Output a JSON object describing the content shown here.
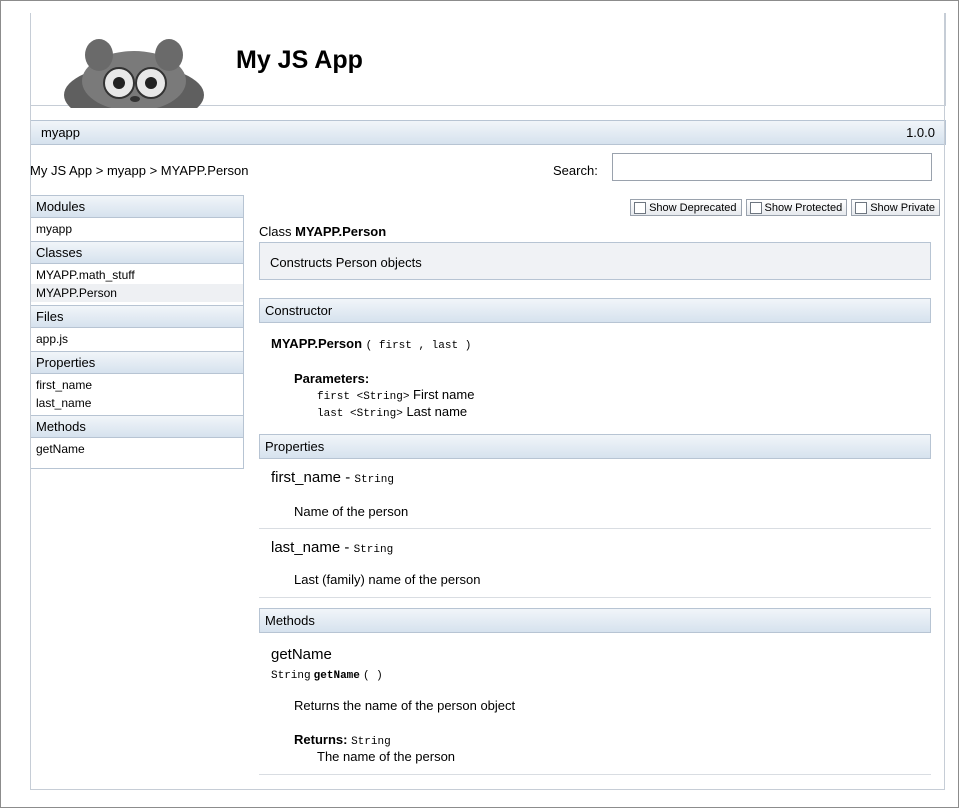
{
  "header": {
    "app_title": "My JS App"
  },
  "module_bar": {
    "name": "myapp",
    "version": "1.0.0"
  },
  "breadcrumb": "My JS App > myapp > MYAPP.Person",
  "search": {
    "label": "Search:",
    "value": ""
  },
  "sidebar": {
    "sections": [
      {
        "title": "Modules",
        "items": [
          "myapp"
        ]
      },
      {
        "title": "Classes",
        "items": [
          "MYAPP.math_stuff",
          "MYAPP.Person"
        ]
      },
      {
        "title": "Files",
        "items": [
          "app.js"
        ]
      },
      {
        "title": "Properties",
        "items": [
          "first_name",
          "last_name"
        ]
      },
      {
        "title": "Methods",
        "items": [
          "getName"
        ]
      }
    ]
  },
  "toggles": {
    "deprecated": "Show Deprecated",
    "protected": "Show Protected",
    "private": "Show Private"
  },
  "class_info": {
    "prefix": "Class",
    "name": "MYAPP.Person",
    "description": "Constructs Person objects"
  },
  "constructor": {
    "heading": "Constructor",
    "signature_name": "MYAPP.Person",
    "signature_args": "( first , last )",
    "params_label": "Parameters:",
    "params": [
      {
        "code": "first <String>",
        "desc": "First name"
      },
      {
        "code": "last <String>",
        "desc": "Last name"
      }
    ]
  },
  "properties": {
    "heading": "Properties",
    "items": [
      {
        "name": "first_name",
        "sep": " - ",
        "type": "String",
        "desc": "Name of the person"
      },
      {
        "name": "last_name",
        "sep": " - ",
        "type": "String",
        "desc": "Last (family) name of the person"
      }
    ]
  },
  "methods": {
    "heading": "Methods",
    "items": [
      {
        "name": "getName",
        "ret_type": "String",
        "sig_name": "getName",
        "sig_args": "( )",
        "desc": "Returns the name of the person object",
        "returns_label": "Returns:",
        "returns_type": "String",
        "returns_desc": "The name of the person"
      }
    ]
  }
}
